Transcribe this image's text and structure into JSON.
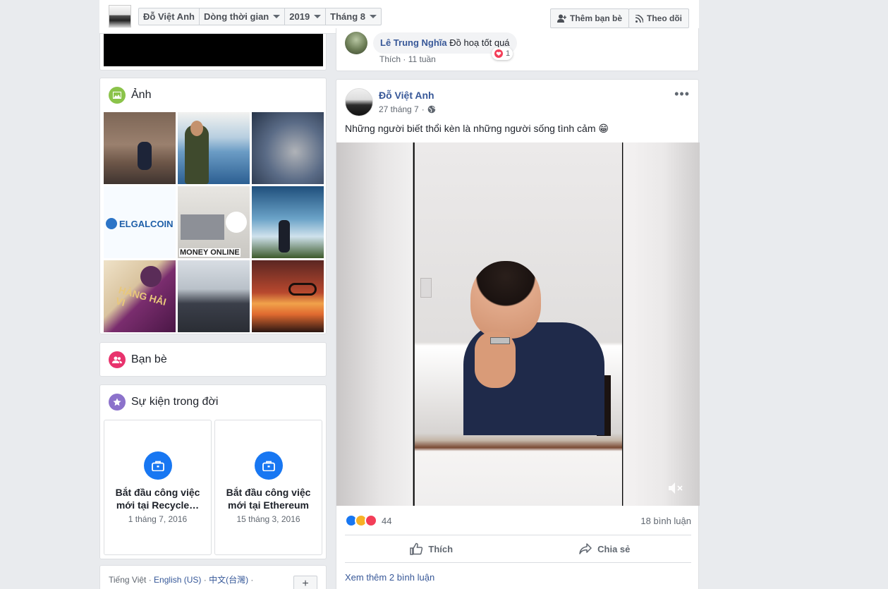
{
  "topbar": {
    "crumbs": [
      "Đỗ Việt Anh",
      "Dòng thời gian",
      "2019",
      "Tháng 8"
    ],
    "add_friend": "Thêm bạn bè",
    "follow": "Theo dõi"
  },
  "photos": {
    "title": "Ảnh",
    "tiles": [
      "ELGALCOIN",
      "MONEY ONLINE",
      "HÀNG HẢI VI"
    ]
  },
  "friends": {
    "title": "Bạn bè"
  },
  "life_events": {
    "title": "Sự kiện trong đời",
    "items": [
      {
        "title": "Bắt đầu công việc mới tại Recycle…",
        "date": "1 tháng 7, 2016"
      },
      {
        "title": "Bắt đầu công việc mới tại Ethereum",
        "date": "15 tháng 3, 2016"
      }
    ]
  },
  "footer": {
    "lang_current": "Tiếng Việt",
    "lang_english": "English (US)",
    "lang_chinese": "中文(台灣)",
    "plus": "+"
  },
  "prev_comment": {
    "name": "Lê Trung Nghĩa",
    "text": "Đồ hoạ tốt quá",
    "like": "Thích",
    "time": "11 tuần",
    "reactions": "1"
  },
  "post": {
    "author": "Đỗ Việt Anh",
    "date": "27 tháng 7",
    "text": "Những người biết thổi kèn là những người sống tình cảm 😁",
    "reaction_count": "44",
    "comment_count": "18 bình luận",
    "like_label": "Thích",
    "share_label": "Chia sẻ",
    "more_comments": "Xem thêm 2 bình luận"
  }
}
